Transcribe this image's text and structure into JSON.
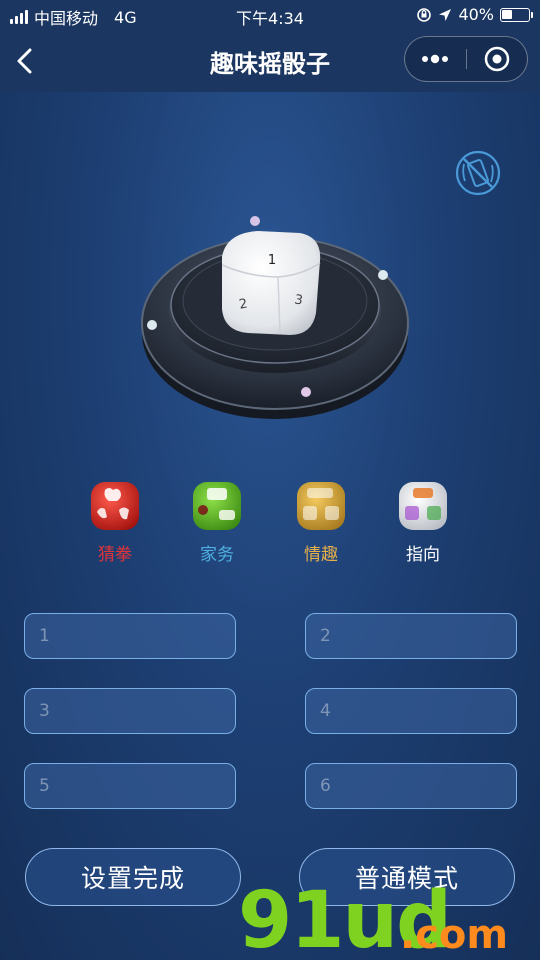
{
  "status_bar": {
    "carrier": "中国移动",
    "network": "4G",
    "time": "下午4:34",
    "battery": "40%",
    "battery_level": 0.4
  },
  "nav": {
    "title": "趣味摇骰子"
  },
  "dice_faces": {
    "top": "1",
    "left": "2",
    "right": "3"
  },
  "categories": [
    {
      "label": "猜拳",
      "color": "#e0343a"
    },
    {
      "label": "家务",
      "color": "#4fb0e0"
    },
    {
      "label": "情趣",
      "color": "#e8b04a"
    },
    {
      "label": "指向",
      "color": "#ffffff"
    }
  ],
  "inputs": [
    {
      "placeholder": "1",
      "value": ""
    },
    {
      "placeholder": "2",
      "value": ""
    },
    {
      "placeholder": "3",
      "value": ""
    },
    {
      "placeholder": "4",
      "value": ""
    },
    {
      "placeholder": "5",
      "value": ""
    },
    {
      "placeholder": "6",
      "value": ""
    }
  ],
  "buttons": {
    "finish": "设置完成",
    "mode": "普通模式"
  },
  "watermark": {
    "main": "91ud",
    "suffix": ".com"
  },
  "icons": {
    "back": "chevron-left-icon",
    "more": "more-dots-icon",
    "close": "target-circle-icon",
    "mute": "phone-shake-off-icon"
  }
}
